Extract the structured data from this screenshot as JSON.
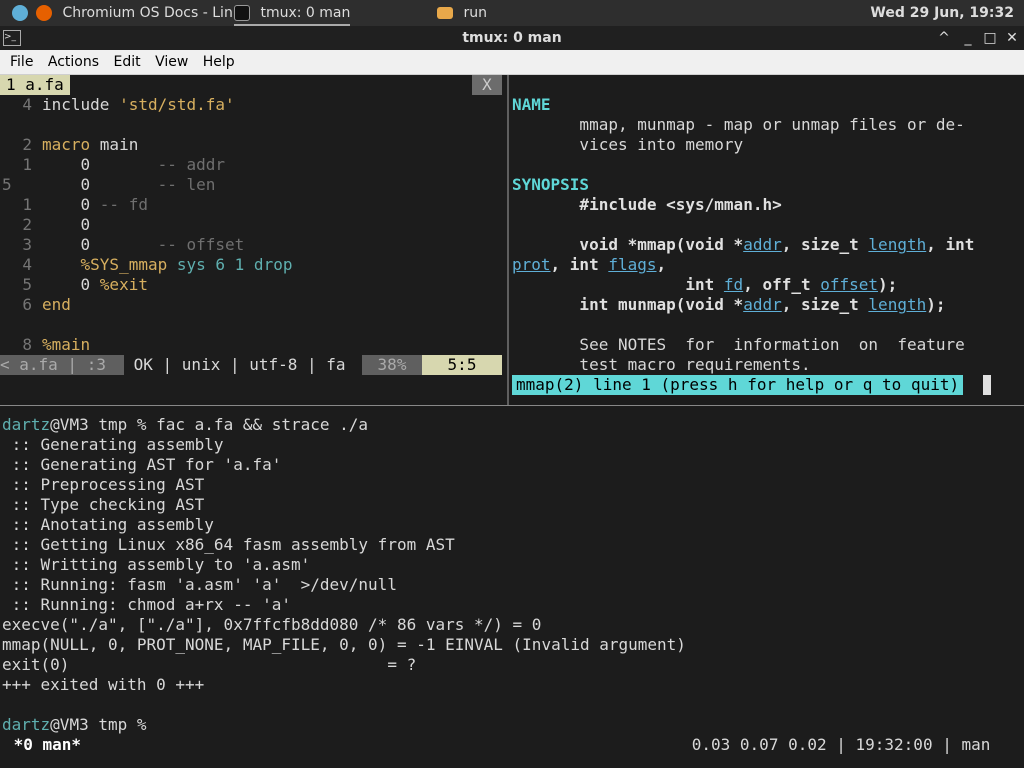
{
  "taskbar": {
    "items": [
      {
        "label": "",
        "icon": "launcher-icon"
      },
      {
        "label": "Chromium OS Docs - Lin...",
        "icon": "firefox-icon"
      },
      {
        "label": "tmux: 0 man",
        "icon": "terminal-icon"
      },
      {
        "label": "run",
        "icon": "folder-icon"
      }
    ],
    "clock": "Wed 29 Jun, 19:32"
  },
  "window": {
    "title": "tmux: 0 man",
    "buttons": [
      "^",
      "_",
      "□",
      "✕"
    ]
  },
  "menu": [
    "File",
    "Actions",
    "Edit",
    "View",
    "Help"
  ],
  "editor": {
    "tab_label": "1 a.fa",
    "tab_close": "X",
    "lines": [
      {
        "num": "4",
        "parts": [
          {
            "t": "include ",
            "c": "plain"
          },
          {
            "t": "'std/std.fa'",
            "c": "str"
          }
        ]
      },
      {
        "num": "",
        "parts": []
      },
      {
        "num": "2",
        "parts": [
          {
            "t": "macro ",
            "c": "kw"
          },
          {
            "t": "main",
            "c": "plain"
          }
        ]
      },
      {
        "num": "1",
        "parts": [
          {
            "t": "    0       ",
            "c": "plain"
          },
          {
            "t": "-- addr",
            "c": "cm"
          }
        ]
      },
      {
        "num": "5",
        "parts": [
          {
            "t": "    0       ",
            "c": "plain"
          },
          {
            "t": "-- len",
            "c": "cm"
          }
        ]
      },
      {
        "num": "1",
        "parts": [
          {
            "t": "    0 ",
            "c": "plain"
          },
          {
            "t": "-- fd",
            "c": "cm"
          }
        ]
      },
      {
        "num": "2",
        "parts": [
          {
            "t": "    0",
            "c": "plain"
          }
        ]
      },
      {
        "num": "3",
        "parts": [
          {
            "t": "    0       ",
            "c": "plain"
          },
          {
            "t": "-- offset",
            "c": "cm"
          }
        ]
      },
      {
        "num": "4",
        "parts": [
          {
            "t": "    ",
            "c": "plain"
          },
          {
            "t": "%SYS_mmap",
            "c": "mac"
          },
          {
            "t": " sys 6 1 drop",
            "c": "teal"
          }
        ]
      },
      {
        "num": "5",
        "parts": [
          {
            "t": "    0 ",
            "c": "plain"
          },
          {
            "t": "%exit",
            "c": "mac"
          }
        ]
      },
      {
        "num": "6",
        "parts": [
          {
            "t": "end",
            "c": "kw"
          }
        ]
      },
      {
        "num": "",
        "parts": []
      },
      {
        "num": "8",
        "parts": [
          {
            "t": "%main",
            "c": "mac"
          }
        ]
      }
    ],
    "status": {
      "file": "< a.fa | :3",
      "info": " OK | unix | utf-8 | fa ",
      "percent": "38%",
      "position": "5:5"
    }
  },
  "manpage": {
    "lines": [
      {
        "parts": []
      },
      {
        "parts": [
          {
            "t": "NAME",
            "c": "head"
          }
        ]
      },
      {
        "parts": [
          {
            "t": "       mmap, munmap - map or unmap files or de-",
            "c": "plain"
          }
        ]
      },
      {
        "parts": [
          {
            "t": "       vices into memory",
            "c": "plain"
          }
        ]
      },
      {
        "parts": []
      },
      {
        "parts": [
          {
            "t": "SYNOPSIS",
            "c": "head"
          }
        ]
      },
      {
        "parts": [
          {
            "t": "       #include <sys/mman.h>",
            "c": "b"
          }
        ]
      },
      {
        "parts": []
      },
      {
        "parts": [
          {
            "t": "       void *mmap(void *",
            "c": "b"
          },
          {
            "t": "addr",
            "c": "u"
          },
          {
            "t": ", size_t ",
            "c": "b"
          },
          {
            "t": "length",
            "c": "u"
          },
          {
            "t": ", int",
            "c": "b"
          }
        ]
      },
      {
        "parts": [
          {
            "t": "prot",
            "c": "u"
          },
          {
            "t": ", int ",
            "c": "b"
          },
          {
            "t": "flags",
            "c": "u"
          },
          {
            "t": ",",
            "c": "b"
          }
        ]
      },
      {
        "parts": [
          {
            "t": "                  int ",
            "c": "b"
          },
          {
            "t": "fd",
            "c": "u"
          },
          {
            "t": ", off_t ",
            "c": "b"
          },
          {
            "t": "offset",
            "c": "u"
          },
          {
            "t": ");",
            "c": "b"
          }
        ]
      },
      {
        "parts": [
          {
            "t": "       int munmap(void *",
            "c": "b"
          },
          {
            "t": "addr",
            "c": "u"
          },
          {
            "t": ", size_t ",
            "c": "b"
          },
          {
            "t": "length",
            "c": "u"
          },
          {
            "t": ");",
            "c": "b"
          }
        ]
      },
      {
        "parts": []
      },
      {
        "parts": [
          {
            "t": "       See NOTES  for  information  on  feature",
            "c": "plain"
          }
        ]
      },
      {
        "parts": [
          {
            "t": "       test macro requirements.",
            "c": "plain"
          }
        ]
      }
    ],
    "status": "mmap(2) line 1 (press h for help or q to quit)"
  },
  "shell": {
    "lines": [
      {
        "parts": [
          {
            "t": "dartz",
            "c": "green"
          },
          {
            "t": "@VM3 tmp % fac a.fa && strace ./a",
            "c": "plain"
          }
        ]
      },
      {
        "parts": [
          {
            "t": " :: Generating assembly",
            "c": "plain"
          }
        ]
      },
      {
        "parts": [
          {
            "t": " :: Generating AST for 'a.fa'",
            "c": "plain"
          }
        ]
      },
      {
        "parts": [
          {
            "t": " :: Preprocessing AST",
            "c": "plain"
          }
        ]
      },
      {
        "parts": [
          {
            "t": " :: Type checking AST",
            "c": "plain"
          }
        ]
      },
      {
        "parts": [
          {
            "t": " :: Anotating assembly",
            "c": "plain"
          }
        ]
      },
      {
        "parts": [
          {
            "t": " :: Getting Linux x86_64 fasm assembly from AST",
            "c": "plain"
          }
        ]
      },
      {
        "parts": [
          {
            "t": " :: Writting assembly to 'a.asm'",
            "c": "plain"
          }
        ]
      },
      {
        "parts": [
          {
            "t": " :: Running: fasm 'a.asm' 'a'  >/dev/null",
            "c": "plain"
          }
        ]
      },
      {
        "parts": [
          {
            "t": " :: Running: chmod a+rx -- 'a'",
            "c": "plain"
          }
        ]
      },
      {
        "parts": [
          {
            "t": "execve(\"./a\", [\"./a\"], 0x7ffcfb8dd080 /* 86 vars */) = 0",
            "c": "plain"
          }
        ]
      },
      {
        "parts": [
          {
            "t": "mmap(NULL, 0, PROT_NONE, MAP_FILE, 0, 0) = -1 EINVAL (Invalid argument)",
            "c": "plain"
          }
        ]
      },
      {
        "parts": [
          {
            "t": "exit(0)                                 = ?",
            "c": "plain"
          }
        ]
      },
      {
        "parts": [
          {
            "t": "+++ exited with 0 +++",
            "c": "plain"
          }
        ]
      },
      {
        "parts": []
      },
      {
        "parts": [
          {
            "t": "dartz",
            "c": "green"
          },
          {
            "t": "@VM3 tmp % ",
            "c": "plain"
          }
        ]
      }
    ]
  },
  "tmux": {
    "window_label": " *0 man*",
    "right": "0.03 0.07 0.02 | 19:32:00 | man "
  }
}
